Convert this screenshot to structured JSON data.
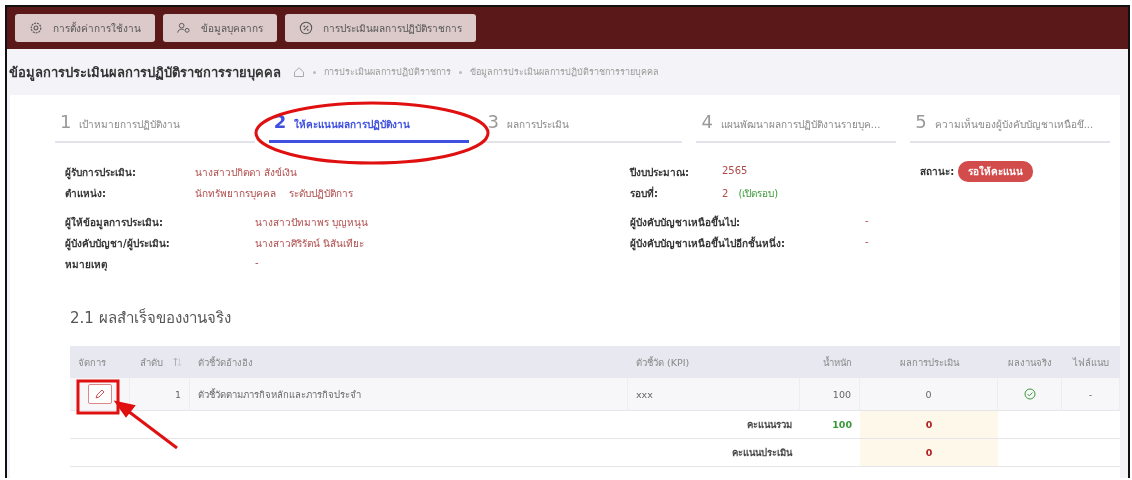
{
  "top_nav": [
    {
      "label": "การตั้งค่าการใช้งาน",
      "kind": "gear"
    },
    {
      "label": "ข้อมูลบุคลากร",
      "kind": "people"
    },
    {
      "label": "การประเมินผลการปฏิบัติราชการ",
      "kind": "percent"
    }
  ],
  "page_title": "ข้อมูลการประเมินผลการปฏิบัติราชการรายบุคคล",
  "breadcrumb": [
    "การประเมินผลการปฏิบัติราชการ",
    "ข้อมูลการประเมินผลการปฏิบัติราชการรายบุคคล"
  ],
  "steps": [
    {
      "number": "1",
      "label": "เป้าหมายการปฏิบัติงาน",
      "selected": false
    },
    {
      "number": "2",
      "label": "ให้คะแนนผลการปฏิบัติงาน",
      "selected": true
    },
    {
      "number": "3",
      "label": "ผลการประเมิน",
      "selected": false
    },
    {
      "number": "4",
      "label": "แผนพัฒนาผลการปฏิบัติงานรายบุค...",
      "selected": false
    },
    {
      "number": "5",
      "label": "ความเห็นของผู้บังคับบัญชาเหนือขึ...",
      "selected": false
    }
  ],
  "summary": {
    "left": [
      {
        "label": "ผู้รับการประเมิน:",
        "value": "นางสาวปกิตดา สังข์เงิน"
      },
      {
        "label": "ตำแหน่ง:",
        "value": "นักทรัพยากรบุคคล    ระดับปฏิบัติการ"
      }
    ],
    "right": [
      {
        "label": "ปีงบประมาณ:",
        "value": "2565"
      },
      {
        "label": "รอบที่:",
        "value": "2",
        "note": "(เปิดรอบ)"
      }
    ],
    "status": {
      "label": "สถานะ:",
      "badge": "รอให้คะแนน"
    }
  },
  "details": {
    "left": [
      {
        "label": "ผู้ให้ข้อมูลการประเมิน:",
        "value": "นางสาวปัทมาพร บุญหนุน"
      },
      {
        "label": "ผู้บังคับบัญชา/ผู้ประเมิน:",
        "value": "นางสาวศิริรัตน์ นิสันเทียะ"
      },
      {
        "label": "หมายเหตุ",
        "value": "-"
      }
    ],
    "right": [
      {
        "label": "ผู้บังคับบัญชาเหนือขึ้นไป:",
        "value": "-"
      },
      {
        "label": "ผู้บังคับบัญชาเหนือขึ้นไปอีกชั้นหนึ่ง:",
        "value": "-"
      }
    ]
  },
  "section_title": "2.1 ผลสำเร็จของงานจริง",
  "table": {
    "columns": [
      {
        "label": "จัดการ",
        "sortable": false
      },
      {
        "label": "ลำดับ",
        "sortable": true
      },
      {
        "label": "ตัวชี้วัดอ้างอิง",
        "sortable": false
      },
      {
        "label": "ตัวชี้วัด (KPI)",
        "sortable": false
      },
      {
        "label": "น้ำหนัก",
        "sortable": false
      },
      {
        "label": "ผลการประเมิน",
        "sortable": false
      },
      {
        "label": "ผลงานจริง",
        "sortable": false
      },
      {
        "label": "ไฟล์แนบ",
        "sortable": false
      }
    ],
    "rows": [
      {
        "number": "1",
        "indicator": "ตัวชี้วัดตามภารกิจหลักและภารกิจประจำ",
        "kpi": "xxx",
        "weight": "100",
        "score": "0",
        "done": true,
        "attachment": "-"
      }
    ],
    "totals": [
      {
        "label": "คะแนนรวม",
        "weight": "100",
        "score": "0"
      },
      {
        "label": "คะแนนประเมิน",
        "score": "0"
      }
    ]
  },
  "annotations": [
    {
      "kind": "ellipse"
    },
    {
      "kind": "frame"
    },
    {
      "kind": "arrow"
    }
  ]
}
